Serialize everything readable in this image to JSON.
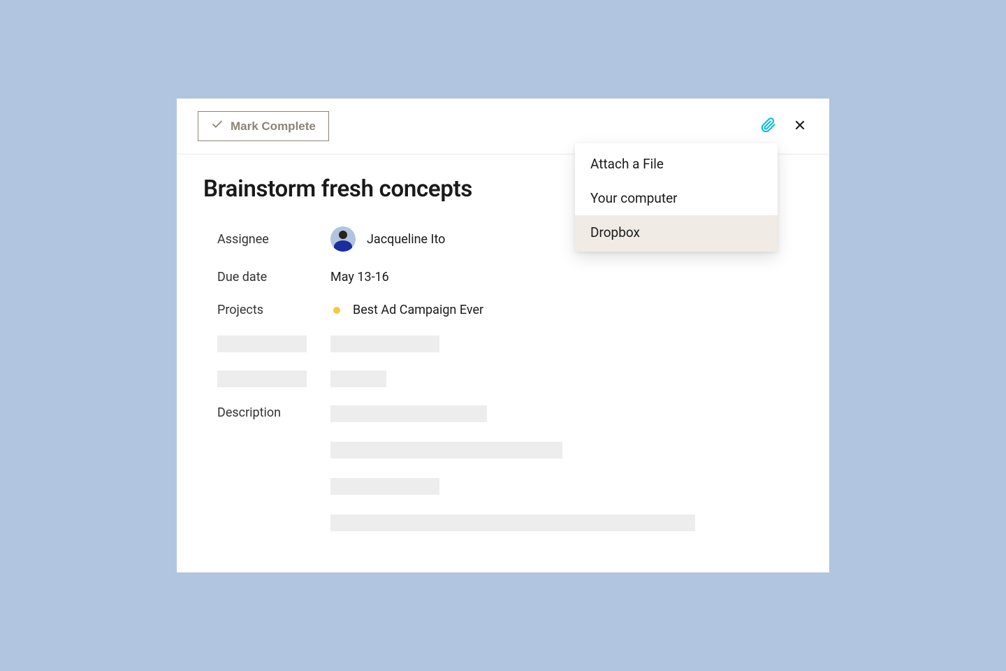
{
  "header": {
    "mark_complete_label": "Mark Complete"
  },
  "task": {
    "title": "Brainstorm fresh concepts",
    "fields": {
      "assignee_label": "Assignee",
      "assignee_name": "Jacqueline Ito",
      "due_date_label": "Due date",
      "due_date_value": "May 13-16",
      "projects_label": "Projects",
      "project_name": "Best Ad Campaign Ever",
      "description_label": "Description"
    }
  },
  "dropdown": {
    "items": [
      {
        "label": "Attach a File",
        "highlighted": false
      },
      {
        "label": "Your computer",
        "highlighted": false
      },
      {
        "label": "Dropbox",
        "highlighted": true
      }
    ]
  }
}
